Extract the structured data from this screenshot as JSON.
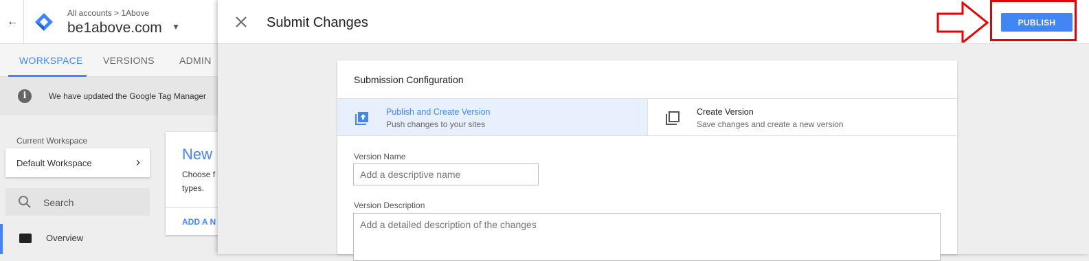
{
  "app": {
    "account_crumb": "All accounts > 1Above",
    "container_name": "be1above.com",
    "tabs": [
      {
        "label": "WORKSPACE",
        "active": true
      },
      {
        "label": "VERSIONS",
        "active": false
      },
      {
        "label": "ADMIN",
        "active": false
      }
    ],
    "notice": "We have updated the Google Tag Manager",
    "sidebar": {
      "current_workspace_label": "Current Workspace",
      "workspace_name": "Default Workspace",
      "search_label": "Search",
      "items": [
        {
          "label": "Overview",
          "active": true
        }
      ]
    },
    "new_card": {
      "title": "New",
      "description_lines": [
        "Choose f",
        "types."
      ],
      "action": "ADD A N"
    }
  },
  "panel": {
    "title": "Submit Changes",
    "publish_label": "PUBLISH",
    "config": {
      "title": "Submission Configuration",
      "options": [
        {
          "title": "Publish and Create Version",
          "subtitle": "Push changes to your sites",
          "selected": true
        },
        {
          "title": "Create Version",
          "subtitle": "Save changes and create a new version",
          "selected": false
        }
      ],
      "version_name": {
        "label": "Version Name",
        "placeholder": "Add a descriptive name",
        "value": ""
      },
      "version_description": {
        "label": "Version Description",
        "placeholder": "Add a detailed description of the changes",
        "value": ""
      }
    }
  },
  "colors": {
    "accent": "#4285f4",
    "selected_option_bg": "#e8f0fe",
    "annotation": "#e60000"
  }
}
